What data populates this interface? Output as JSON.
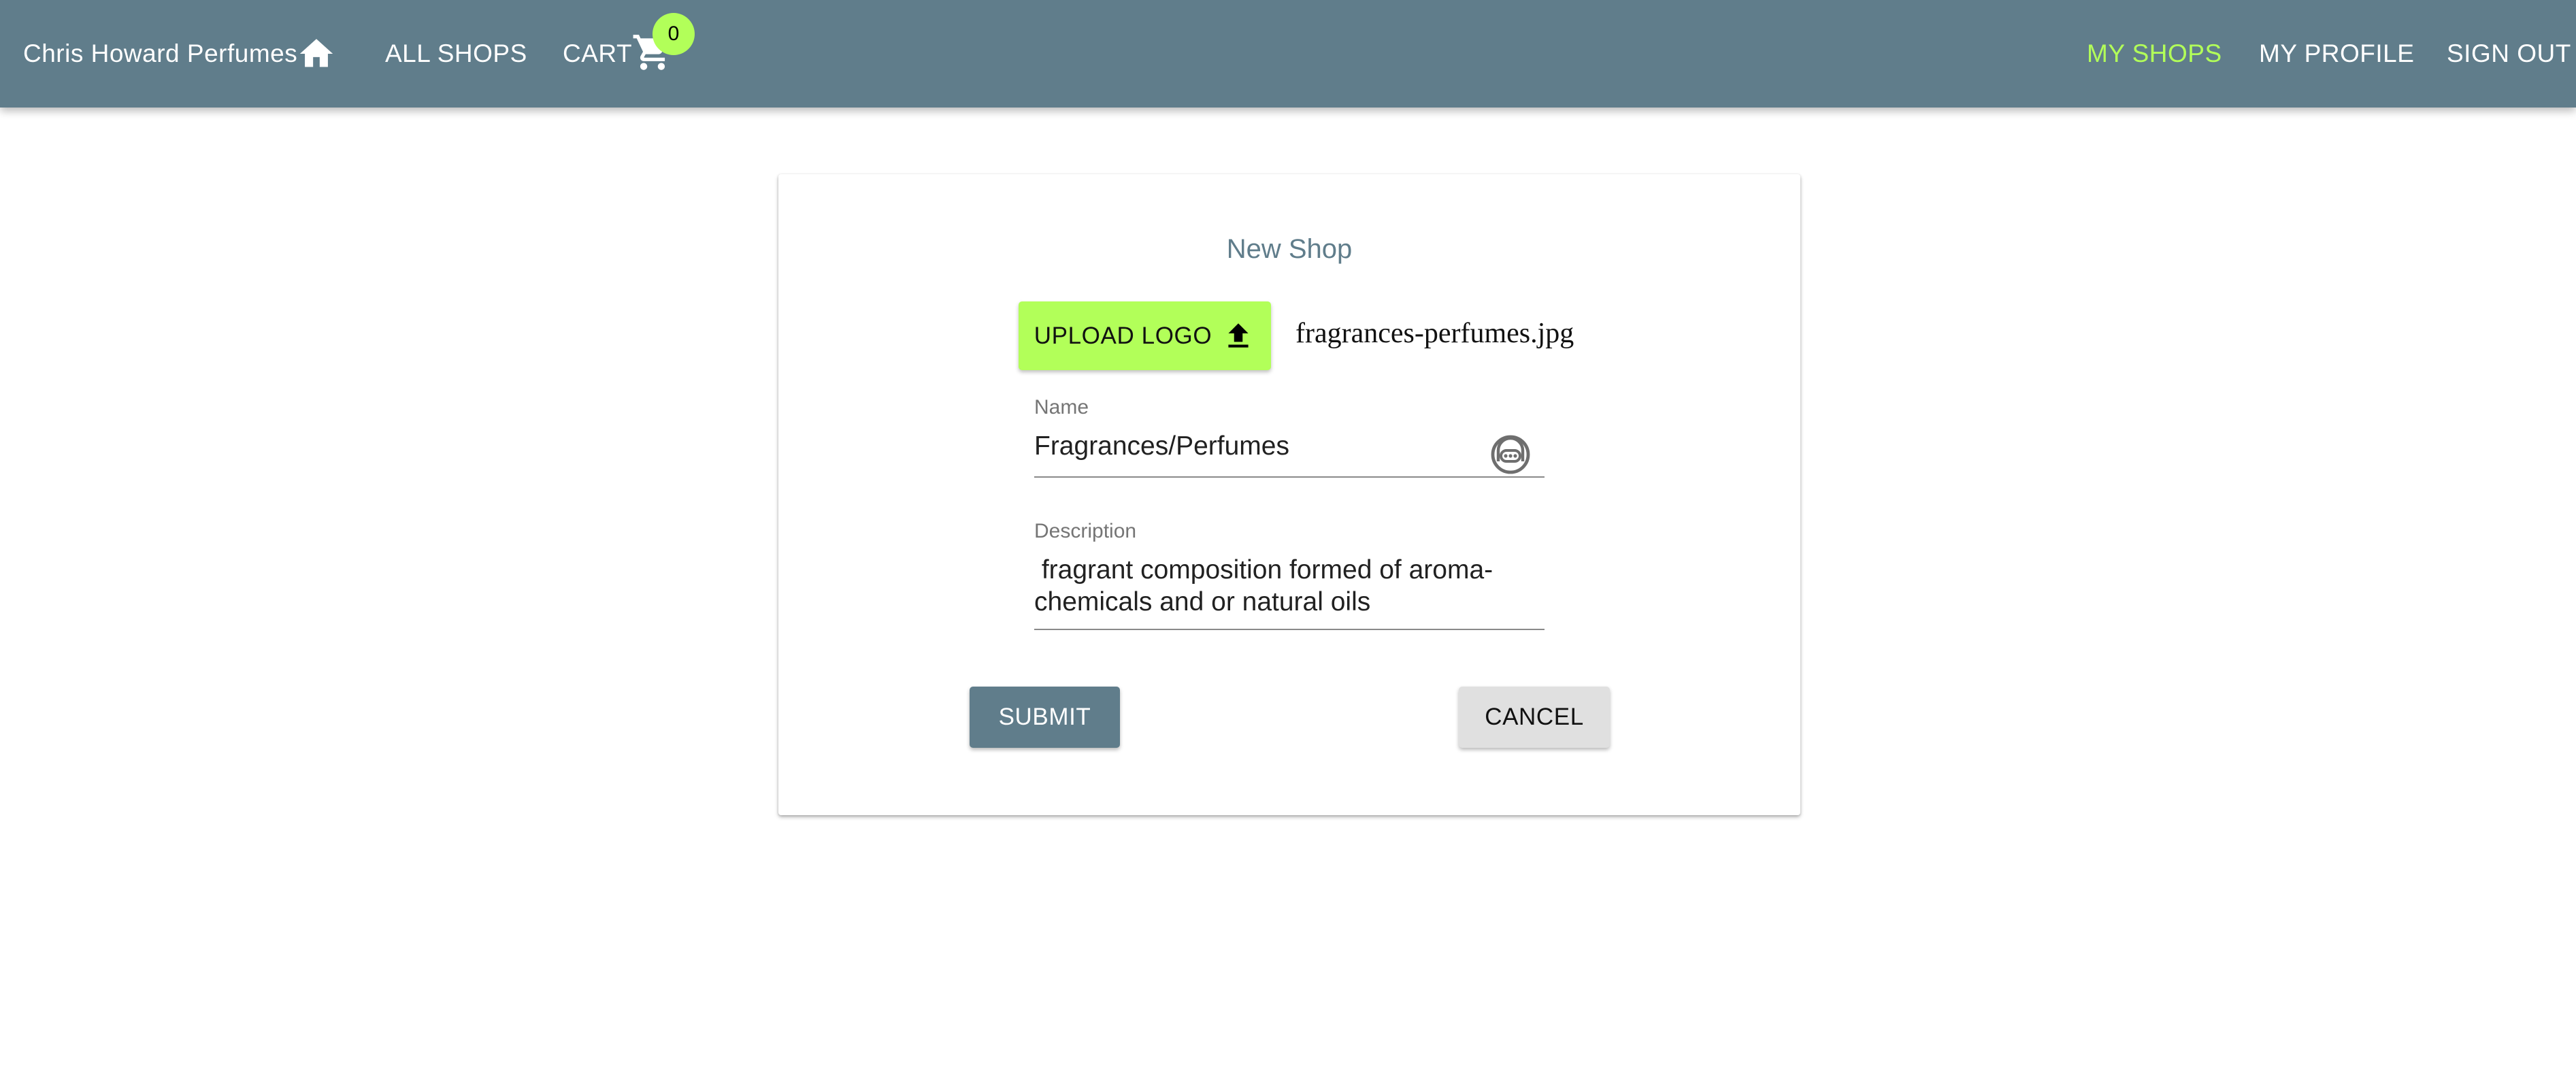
{
  "app": {
    "brand": "Chris Howard Perfumes"
  },
  "nav": {
    "home_icon": "home-icon",
    "all_shops": "ALL SHOPS",
    "cart": "CART",
    "cart_icon": "shopping-cart-icon",
    "cart_count": "0",
    "my_shops": "MY SHOPS",
    "my_profile": "MY PROFILE",
    "sign_out": "SIGN OUT"
  },
  "form": {
    "title": "New Shop",
    "upload_label": "UPLOAD LOGO",
    "upload_icon": "upload-icon",
    "file_name": "fragrances-perfumes.jpg",
    "name_label": "Name",
    "name_value": "Fragrances/Perfumes",
    "name_field_icon": "password-manager-icon",
    "description_label": "Description",
    "description_value": " fragrant composition formed of aroma-chemicals and or natural oils",
    "submit_label": "SUBMIT",
    "cancel_label": "CANCEL"
  },
  "colors": {
    "appbar": "#607d8b",
    "accent": "#b2ff59",
    "title": "#607d8b",
    "cancel_button": "#e0e0e0"
  }
}
